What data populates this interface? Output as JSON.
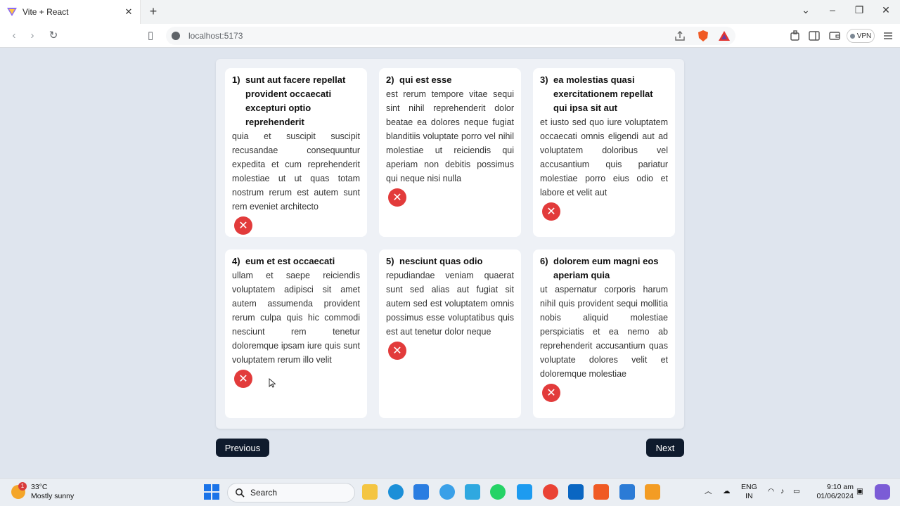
{
  "browser": {
    "tab_title": "Vite + React",
    "url": "localhost:5173",
    "vpn_label": "VPN"
  },
  "posts": [
    {
      "num": "1)",
      "title": "sunt aut facere repellat provident occaecati excepturi optio reprehenderit",
      "body": "quia et suscipit suscipit recusandae consequuntur expedita et cum reprehenderit molestiae ut ut quas totam nostrum rerum est autem sunt rem eveniet architecto"
    },
    {
      "num": "2)",
      "title": "qui est esse",
      "body": "est rerum tempore vitae sequi sint nihil reprehenderit dolor beatae ea dolores neque fugiat blanditiis voluptate porro vel nihil molestiae ut reiciendis qui aperiam non debitis possimus qui neque nisi nulla"
    },
    {
      "num": "3)",
      "title": "ea molestias quasi exercitationem repellat qui ipsa sit aut",
      "body": "et iusto sed quo iure voluptatem occaecati omnis eligendi aut ad voluptatem doloribus vel accusantium quis pariatur molestiae porro eius odio et labore et velit aut"
    },
    {
      "num": "4)",
      "title": "eum et est occaecati",
      "body": "ullam et saepe reiciendis voluptatem adipisci sit amet autem assumenda provident rerum culpa quis hic commodi nesciunt rem tenetur doloremque ipsam iure quis sunt voluptatem rerum illo velit"
    },
    {
      "num": "5)",
      "title": "nesciunt quas odio",
      "body": "repudiandae veniam quaerat sunt sed alias aut fugiat sit autem sed est voluptatem omnis possimus esse voluptatibus quis est aut tenetur dolor neque"
    },
    {
      "num": "6)",
      "title": "dolorem eum magni eos aperiam quia",
      "body": "ut aspernatur corporis harum nihil quis provident sequi mollitia nobis aliquid molestiae perspiciatis et ea nemo ab reprehenderit accusantium quas voluptate dolores velit et doloremque molestiae"
    }
  ],
  "delete_icon": "close-icon",
  "pagination": {
    "previous_label": "Previous",
    "next_label": "Next"
  },
  "taskbar": {
    "weather_temp": "33°C",
    "weather_desc": "Mostly sunny",
    "weather_badge": "1",
    "search_label": "Search",
    "lang_top": "ENG",
    "lang_bottom": "IN",
    "time": "9:10 am",
    "date": "01/06/2024"
  },
  "colors": {
    "accent": "#0f1b2d",
    "delete": "#e23b3b",
    "background": "#dfe5ee"
  }
}
